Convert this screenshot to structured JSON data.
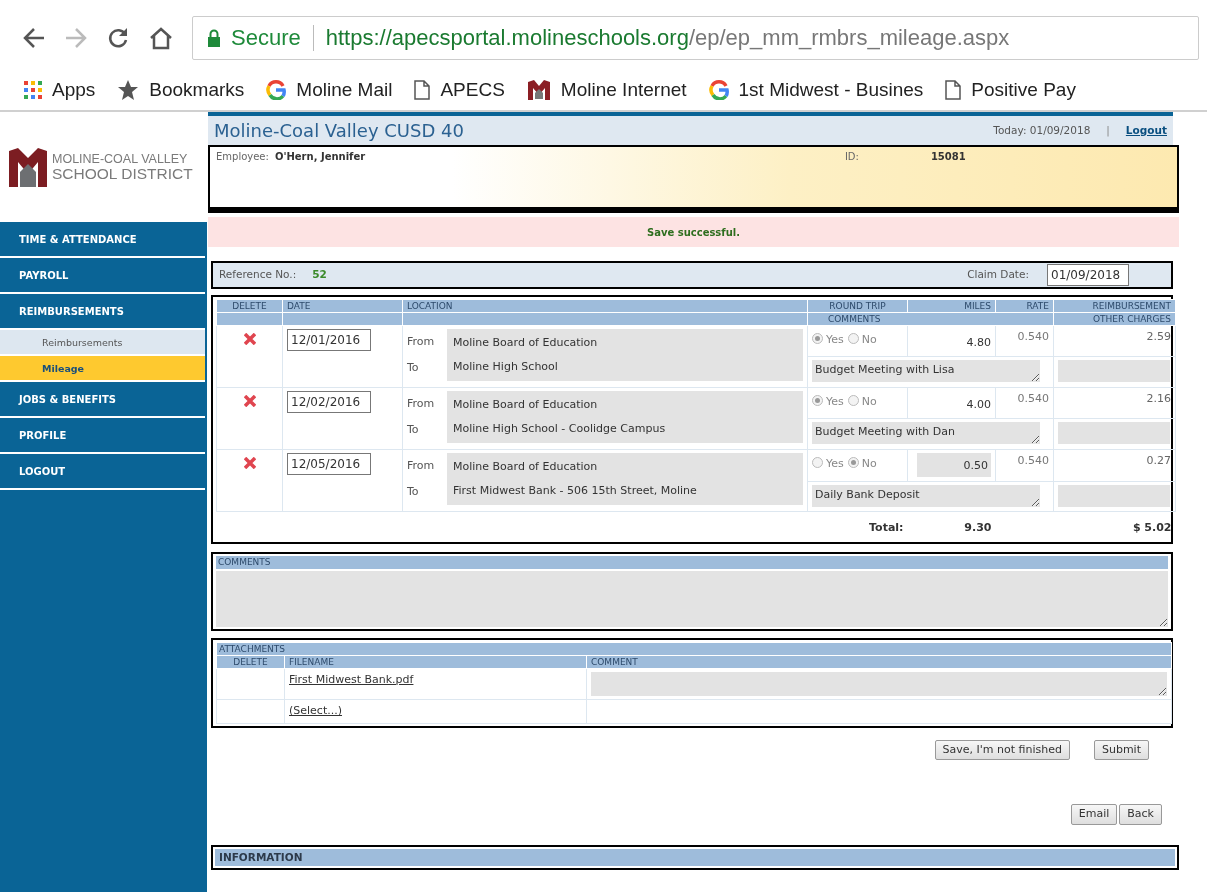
{
  "browser": {
    "secure_label": "Secure",
    "url_host": "https://apecsportal.molineschools.org",
    "url_path": "/ep/ep_mm_rmbrs_mileage.aspx",
    "bookmarks": [
      {
        "kind": "apps",
        "label": "Apps"
      },
      {
        "kind": "star",
        "label": "Bookmarks"
      },
      {
        "kind": "ring",
        "label": "Moline Mail"
      },
      {
        "kind": "page",
        "label": "APECS"
      },
      {
        "kind": "logo",
        "label": "Moline Internet"
      },
      {
        "kind": "ring",
        "label": "1st Midwest - Busines"
      },
      {
        "kind": "page",
        "label": "Positive Pay"
      }
    ]
  },
  "sidebar": {
    "logo_lines": [
      "MOLINE-COAL VALLEY",
      "SCHOOL DISTRICT"
    ],
    "items": [
      {
        "label": "TIME & ATTENDANCE",
        "selected": false
      },
      {
        "label": "PAYROLL",
        "selected": false
      },
      {
        "label": "REIMBURSEMENTS",
        "selected": false,
        "children": [
          {
            "label": "Reimbursements",
            "selected": false
          },
          {
            "label": "Mileage",
            "selected": true
          }
        ]
      },
      {
        "label": "JOBS & BENEFITS",
        "selected": false
      },
      {
        "label": "PROFILE",
        "selected": false
      },
      {
        "label": "LOGOUT",
        "selected": false
      }
    ]
  },
  "header": {
    "title": "Moline-Coal Valley CUSD 40",
    "today": "Today: 01/09/2018",
    "separator": "|",
    "logout": "Logout"
  },
  "employee": {
    "label": "Employee:",
    "name": "O'Hern, Jennifer",
    "id_label": "ID:",
    "id": "15081"
  },
  "message": "Save successful.",
  "reference": {
    "label": "Reference No.:",
    "value": "52",
    "claim_label": "Claim Date:",
    "claim_date": "01/09/2018"
  },
  "mileage": {
    "columns": [
      "DELETE",
      "DATE",
      "LOCATION",
      "ROUND TRIP",
      "MILES",
      "RATE",
      "REIMBURSEMENT"
    ],
    "subcolumns": [
      "COMMENTS",
      "OTHER CHARGES"
    ],
    "rows": [
      {
        "date": "12/01/2016",
        "from_label": "From",
        "from": "Moline Board of Education",
        "to_label": "To",
        "to": "Moline High School",
        "yes_label": "Yes",
        "no_label": "No",
        "round_trip": true,
        "miles": "4.80",
        "miles_editable": false,
        "rate": "0.540",
        "reimbursement": "2.59",
        "comment": "Budget Meeting with Lisa"
      },
      {
        "date": "12/02/2016",
        "from_label": "From",
        "from": "Moline Board of Education",
        "to_label": "To",
        "to": "Moline High School - Coolidge Campus",
        "yes_label": "Yes",
        "no_label": "No",
        "round_trip": true,
        "miles": "4.00",
        "miles_editable": false,
        "rate": "0.540",
        "reimbursement": "2.16",
        "comment": "Budget Meeting with Dan"
      },
      {
        "date": "12/05/2016",
        "from_label": "From",
        "from": "Moline Board of Education",
        "to_label": "To",
        "to": "First Midwest Bank - 506 15th Street, Moline",
        "yes_label": "Yes",
        "no_label": "No",
        "round_trip": false,
        "miles": "0.50",
        "miles_editable": true,
        "rate": "0.540",
        "reimbursement": "0.27",
        "comment": "Daily Bank Deposit"
      }
    ],
    "total_label": "Total:",
    "total_miles": "9.30",
    "total_amount": "$ 5.02"
  },
  "comments": {
    "header": "COMMENTS"
  },
  "attachments": {
    "header": "ATTACHMENTS",
    "columns": [
      "DELETE",
      "FILENAME",
      "COMMENT"
    ],
    "files": [
      {
        "filename": "First Midwest Bank.pdf"
      }
    ],
    "select_link": "(Select...)"
  },
  "buttons": [
    "Save, I'm not finished",
    "Submit"
  ],
  "nav_buttons": [
    "Email",
    "Back"
  ],
  "information": "INFORMATION"
}
